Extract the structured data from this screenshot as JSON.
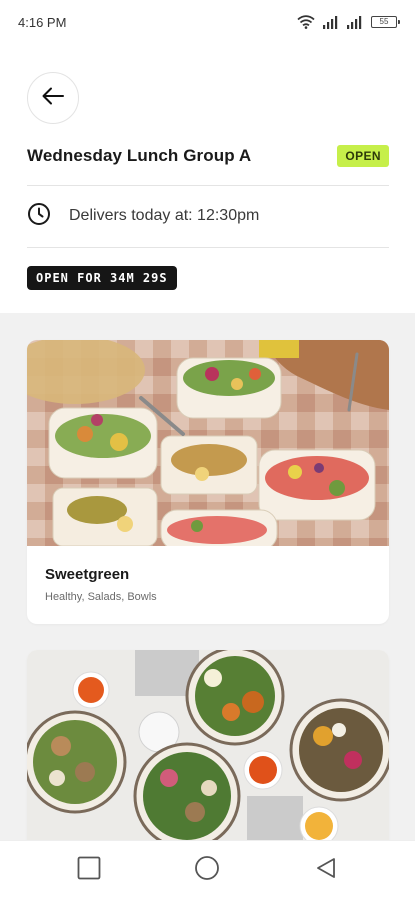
{
  "status_bar": {
    "time": "4:16 PM",
    "battery": "55"
  },
  "header": {
    "title": "Wednesday Lunch Group A",
    "status_badge": "OPEN",
    "delivery_text": "Delivers today at: 12:30pm",
    "countdown": "OPEN FOR 34M 29S"
  },
  "restaurants": [
    {
      "name": "Sweetgreen",
      "tags": "Healthy, Salads, Bowls"
    },
    {
      "name": "",
      "tags": ""
    }
  ],
  "colors": {
    "badge_bg": "#c6ef4a",
    "timer_bg": "#161616",
    "content_bg": "#f1f1f1"
  },
  "icons": {
    "back": "arrow-left-icon",
    "clock": "clock-icon",
    "nav_recent": "square-icon",
    "nav_home": "circle-icon",
    "nav_back": "triangle-back-icon"
  }
}
